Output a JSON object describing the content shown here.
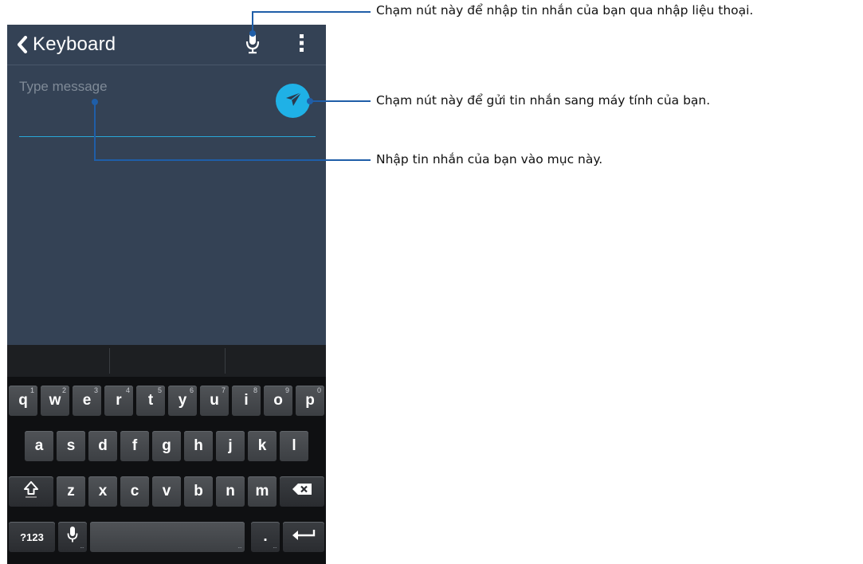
{
  "app": {
    "title": "Keyboard"
  },
  "message": {
    "placeholder": "Type message"
  },
  "icons": {
    "back": "chevron-left-icon",
    "mic": "microphone-icon",
    "more": "more-vertical-icon",
    "send": "paper-plane-icon",
    "shift": "shift-arrow-icon",
    "backspace": "backspace-icon",
    "enter": "enter-arrow-icon"
  },
  "keyboard": {
    "row1": [
      {
        "key": "q",
        "hint": "1"
      },
      {
        "key": "w",
        "hint": "2"
      },
      {
        "key": "e",
        "hint": "3"
      },
      {
        "key": "r",
        "hint": "4"
      },
      {
        "key": "t",
        "hint": "5"
      },
      {
        "key": "y",
        "hint": "6"
      },
      {
        "key": "u",
        "hint": "7"
      },
      {
        "key": "i",
        "hint": "8"
      },
      {
        "key": "o",
        "hint": "9"
      },
      {
        "key": "p",
        "hint": "0"
      }
    ],
    "row2": [
      "a",
      "s",
      "d",
      "f",
      "g",
      "h",
      "j",
      "k",
      "l"
    ],
    "row3": [
      "z",
      "x",
      "c",
      "v",
      "b",
      "n",
      "m"
    ],
    "symbols_label": "?123",
    "period_label": "."
  },
  "callouts": {
    "mic": "Chạm nút này để nhập tin nhắn của bạn qua nhập liệu thoại.",
    "send": "Chạm nút này để gửi tin nhắn sang máy tính của bạn.",
    "input": "Nhập tin nhắn của bạn vào mục này."
  },
  "colors": {
    "accent": "#1fb1e6",
    "callout": "#1f5ea8",
    "background": "#344255"
  }
}
